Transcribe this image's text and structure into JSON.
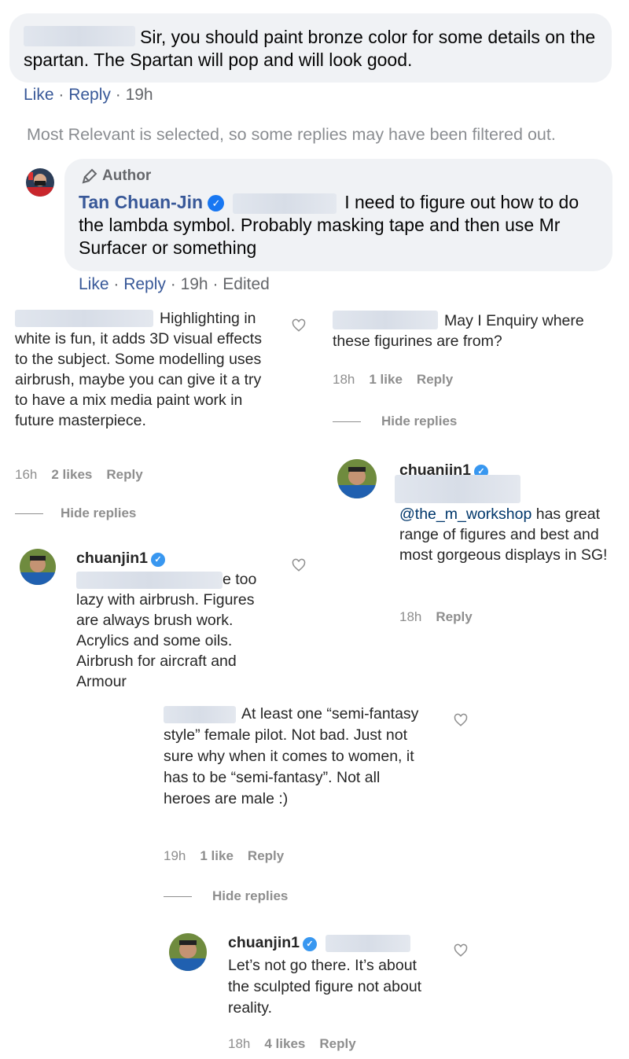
{
  "fb": {
    "top_comment": {
      "text": "Sir, you should paint bronze color for some details on the spartan. The Spartan will pop and will look good.",
      "like": "Like",
      "reply": "Reply",
      "time": "19h"
    },
    "filter_note": "Most Relevant is selected, so some replies may have been filtered out.",
    "author_reply": {
      "badge": "Author",
      "name": "Tan Chuan-Jin",
      "text": "I need to figure out how to do the lambda symbol. Probably masking tape and then use Mr Surfacer or something",
      "like": "Like",
      "reply": "Reply",
      "time": "19h",
      "edited": "Edited"
    }
  },
  "ig_left": {
    "comment": {
      "text": "Highlighting in white is fun, it adds 3D visual effects to the subject. Some modelling uses airbrush, maybe you can give it a try to have a mix media paint work in future masterpiece.",
      "time": "16h",
      "likes": "2 likes",
      "reply": "Reply"
    },
    "hide_replies": "Hide replies",
    "reply": {
      "user": "chuanjin1",
      "text_end": "e too",
      "text": "lazy with airbrush. Figures are always brush work. Acrylics and some oils. Airbrush for aircraft and Armour"
    }
  },
  "ig_right": {
    "comment": {
      "text": "May I Enquiry where these figurines are from?",
      "time": "18h",
      "likes": "1 like",
      "reply": "Reply"
    },
    "hide_replies": "Hide replies",
    "reply": {
      "user": "chuanjin1",
      "mention": "@the_m_workshop",
      "text": "has great range of figures and best and most gorgeous displays in SG!",
      "time": "18h",
      "reply": "Reply"
    }
  },
  "ig_bottom": {
    "comment": {
      "text": "At least one “semi-fantasy style” female pilot. Not bad. Just not sure why when it comes to women, it has to be “semi-fantasy”. Not all heroes are male :)",
      "time": "19h",
      "likes": "1 like",
      "reply": "Reply"
    },
    "hide_replies": "Hide replies",
    "reply": {
      "user": "chuanjin1",
      "text": "Let’s not go there. It’s about the sculpted figure not about reality.",
      "time": "18h",
      "likes": "4 likes",
      "reply": "Reply"
    }
  }
}
